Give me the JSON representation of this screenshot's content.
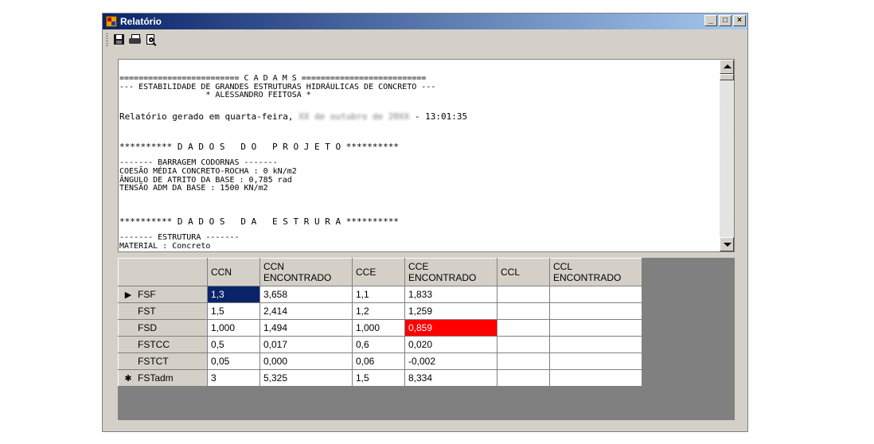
{
  "window": {
    "title": "Relatório",
    "caption_buttons": [
      "_",
      "□",
      "×"
    ]
  },
  "toolbar": {
    "buttons": [
      {
        "name": "save",
        "icon": "floppy-disk-icon"
      },
      {
        "name": "print",
        "icon": "printer-icon"
      },
      {
        "name": "print-preview",
        "icon": "print-preview-icon"
      }
    ]
  },
  "report": {
    "lines": [
      "========================= C A D A M S ==========================",
      "--- ESTABILIDADE DE GRANDES ESTRUTURAS HIDRÁULICAS DE CONCRETO ---",
      "                  * ALESSANDRO FEITOSA *",
      "",
      "Relatório gerado em quarta-feira,",
      "",
      "",
      "********** D A D O S   D O   P R O J E T O **********",
      "",
      "------- BARRAGEM CODORNAS -------",
      "COESÃO MÉDIA CONCRETO-ROCHA : 0 kN/m2",
      "ÂNGULO DE ATRITO DA BASE : 0,785 rad",
      "TENSÃO ADM DA BASE : 1500 KN/m2",
      "",
      "",
      "********** D A D O S   D A   E S T R U R A **********",
      "",
      "------- ESTRUTURA -------",
      "MATERIAL : Concreto"
    ],
    "date_blurred": "XX de outubro de 20XX",
    "time_suffix": " - 13:01:35"
  },
  "grid": {
    "columns": [
      "CCN",
      "CCN ENCONTRADO",
      "CCE",
      "CCE ENCONTRADO",
      "CCL",
      "CCL ENCONTRADO"
    ],
    "rows": [
      {
        "indicator": "▶",
        "label": "FSF",
        "cells": [
          "1,3",
          "3,658",
          "1,1",
          "1,833",
          "",
          ""
        ]
      },
      {
        "indicator": "",
        "label": "FST",
        "cells": [
          "1,5",
          "2,414",
          "1,2",
          "1,259",
          "",
          ""
        ]
      },
      {
        "indicator": "",
        "label": "FSD",
        "cells": [
          "1,000",
          "1,494",
          "1,000",
          "0,859",
          "",
          ""
        ]
      },
      {
        "indicator": "",
        "label": "FSTCC",
        "cells": [
          "0,5",
          "0,017",
          "0,6",
          "0,020",
          "",
          ""
        ]
      },
      {
        "indicator": "",
        "label": "FSTCT",
        "cells": [
          "0,05",
          "0,000",
          "0,06",
          "-0,002",
          "",
          ""
        ]
      },
      {
        "indicator": "✱",
        "label": "FSTadm",
        "cells": [
          "3",
          "5,325",
          "1,5",
          "8,334",
          "",
          ""
        ]
      }
    ],
    "selected_cell": {
      "row": 0,
      "col": 0
    },
    "highlighted_cell": {
      "row": 2,
      "col": 3,
      "color": "#ff0000"
    }
  },
  "colors": {
    "title_bar_start": "#0a246a",
    "title_bar_end": "#a6caf0",
    "selection": "#0a246a",
    "alert": "#ff0000"
  }
}
